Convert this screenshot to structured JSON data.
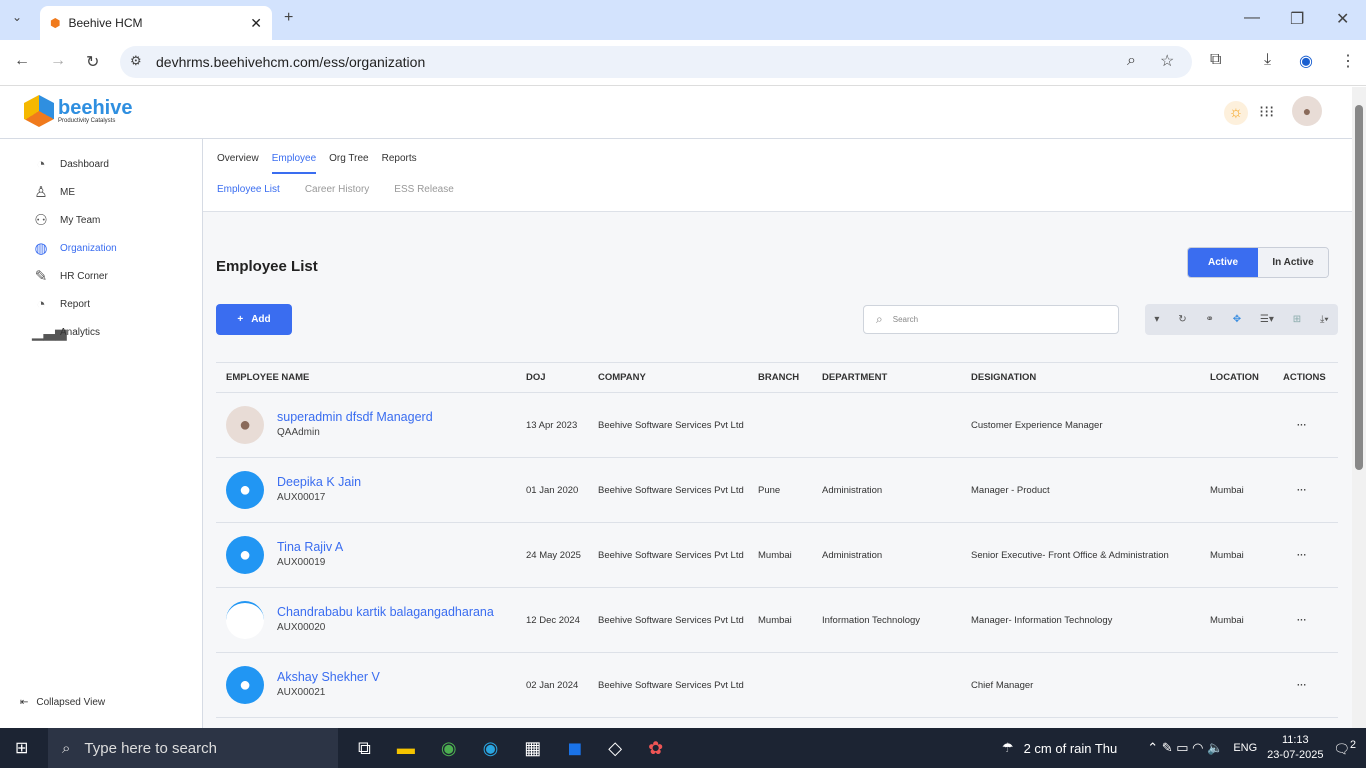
{
  "browser": {
    "tab_title": "Beehive HCM",
    "url": "devhrms.beehivehcm.com/ess/organization"
  },
  "logo": {
    "name": "beehive",
    "tagline": "Productivity Catalysts"
  },
  "sidebar": {
    "items": [
      {
        "label": "Dashboard",
        "icon": "pie-chart-icon"
      },
      {
        "label": "ME",
        "icon": "user-icon"
      },
      {
        "label": "My Team",
        "icon": "team-icon"
      },
      {
        "label": "Organization",
        "icon": "globe-icon"
      },
      {
        "label": "HR Corner",
        "icon": "edit-icon"
      },
      {
        "label": "Report",
        "icon": "report-icon"
      },
      {
        "label": "Analytics",
        "icon": "bar-chart-icon"
      }
    ],
    "collapse_label": "Collapsed View"
  },
  "tabs": [
    "Overview",
    "Employee",
    "Org Tree",
    "Reports"
  ],
  "subtabs": [
    "Employee List",
    "Career History",
    "ESS Release"
  ],
  "page_title": "Employee List",
  "toggle": {
    "active": "Active",
    "inactive": "In Active"
  },
  "add_label": "Add",
  "search_placeholder": "Search",
  "table": {
    "headers": [
      "EMPLOYEE NAME",
      "DOJ",
      "COMPANY",
      "BRANCH",
      "DEPARTMENT",
      "DESIGNATION",
      "LOCATION",
      "ACTIONS"
    ],
    "rows": [
      {
        "name": "superadmin dfsdf Managerd",
        "code": "QAAdmin",
        "doj": "13 Apr 2023",
        "company": "Beehive Software Services Pvt Ltd",
        "branch": "",
        "department": "",
        "designation": "Customer Experience Manager",
        "location": "",
        "actions": "···"
      },
      {
        "name": "Deepika K Jain",
        "code": "AUX00017",
        "doj": "01 Jan 2020",
        "company": "Beehive Software Services Pvt Ltd",
        "branch": "Pune",
        "department": "Administration",
        "designation": "Manager - Product",
        "location": "Mumbai",
        "actions": "···"
      },
      {
        "name": "Tina Rajiv A",
        "code": "AUX00019",
        "doj": "24 May 2025",
        "company": "Beehive Software Services Pvt Ltd",
        "branch": "Mumbai",
        "department": "Administration",
        "designation": "Senior Executive- Front Office & Administration",
        "location": "Mumbai",
        "actions": "···"
      },
      {
        "name": "Chandrababu kartik balagangadharana",
        "code": "AUX00020",
        "doj": "12 Dec 2024",
        "company": "Beehive Software Services Pvt Ltd",
        "branch": "Mumbai",
        "department": "Information Technology",
        "designation": "Manager- Information Technology",
        "location": "Mumbai",
        "actions": "···"
      },
      {
        "name": "Akshay Shekher V",
        "code": "AUX00021",
        "doj": "02 Jan 2024",
        "company": "Beehive Software Services Pvt Ltd",
        "branch": "",
        "department": "",
        "designation": "Chief Manager",
        "location": "",
        "actions": "···"
      }
    ]
  },
  "taskbar": {
    "search": "Type here to search",
    "weather": "2 cm of rain Thu",
    "lang": "ENG",
    "time": "11:13",
    "date": "23-07-2025",
    "notifications": "2"
  }
}
